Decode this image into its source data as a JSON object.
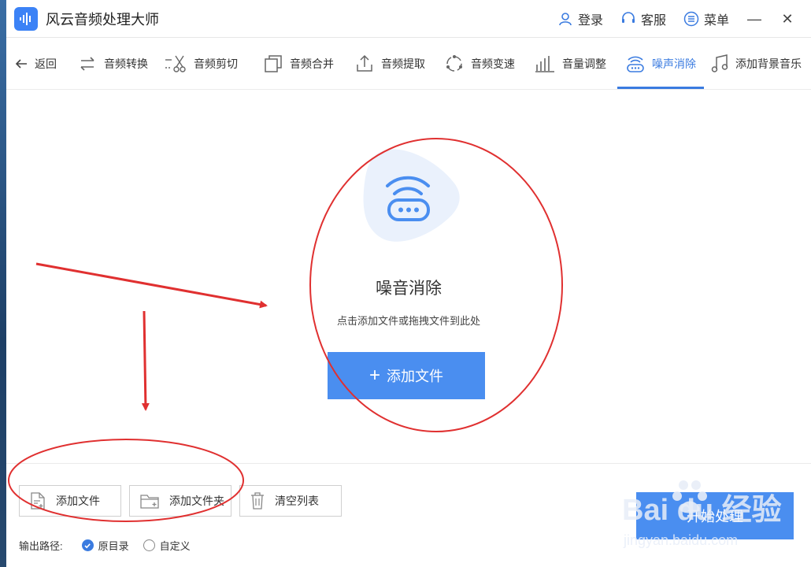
{
  "app": {
    "title": "风云音频处理大师"
  },
  "header": {
    "login": "登录",
    "service": "客服",
    "menu": "菜单",
    "minimize": "—",
    "close": "✕"
  },
  "toolbar": {
    "back": "返回",
    "items": [
      {
        "label": "音频转换",
        "icon": "convert-icon"
      },
      {
        "label": "音频剪切",
        "icon": "scissors-icon"
      },
      {
        "label": "音频合并",
        "icon": "merge-icon"
      },
      {
        "label": "音频提取",
        "icon": "extract-icon"
      },
      {
        "label": "音频变速",
        "icon": "speed-icon"
      },
      {
        "label": "音量调整",
        "icon": "volume-bars-icon"
      },
      {
        "label": "噪声消除",
        "icon": "noise-icon",
        "active": true
      },
      {
        "label": "添加背景音乐",
        "icon": "music-note-icon"
      }
    ]
  },
  "main": {
    "title": "噪音消除",
    "subtitle": "点击添加文件或拖拽文件到此处",
    "add_button": "添加文件"
  },
  "bottom": {
    "add_file": "添加文件",
    "add_folder": "添加文件夹",
    "clear_list": "清空列表",
    "output_label": "输出路径:",
    "option_original": "原目录",
    "option_custom": "自定义",
    "start": "开始处理"
  },
  "watermark": {
    "brand": "Bai du 经验",
    "url": "jingyan.baidu.com"
  },
  "colors": {
    "accent": "#3a7be0",
    "button": "#4a8ef0",
    "annotation": "#e03030"
  }
}
